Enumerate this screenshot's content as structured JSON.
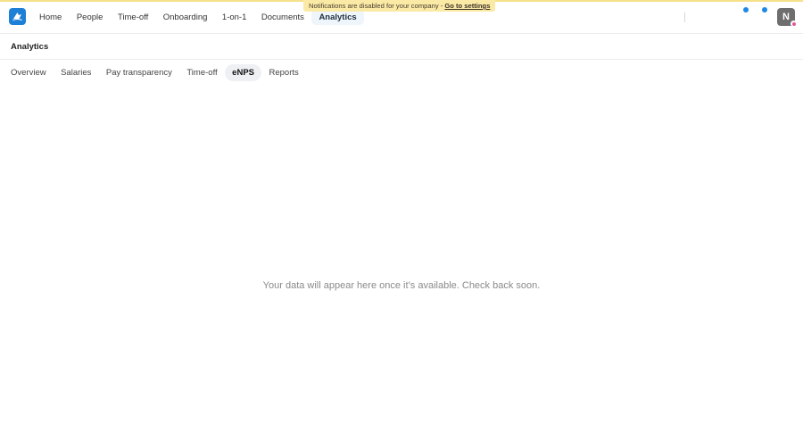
{
  "banner": {
    "text": "Notifications are disabled for your company - ",
    "link": "Go to settings"
  },
  "nav": {
    "items": [
      {
        "label": "Home"
      },
      {
        "label": "People"
      },
      {
        "label": "Time-off"
      },
      {
        "label": "Onboarding"
      },
      {
        "label": "1-on-1"
      },
      {
        "label": "Documents"
      },
      {
        "label": "Analytics",
        "active": true
      }
    ]
  },
  "user": {
    "initial": "N"
  },
  "page": {
    "title": "Analytics"
  },
  "subtabs": {
    "items": [
      {
        "label": "Overview"
      },
      {
        "label": "Salaries"
      },
      {
        "label": "Pay transparency"
      },
      {
        "label": "Time-off"
      },
      {
        "label": "eNPS",
        "active": true
      },
      {
        "label": "Reports"
      }
    ]
  },
  "empty_state": {
    "message": "Your data will appear here once it’s available. Check back soon."
  },
  "colors": {
    "accent": "#1e88e5",
    "banner_bg": "#fbe9a6",
    "active_nav_bg": "#eef5fb",
    "active_tab_bg": "#eef0f3"
  },
  "icons": {
    "logo": "app-logo-icon",
    "status_dots": "status-dot-icon"
  }
}
